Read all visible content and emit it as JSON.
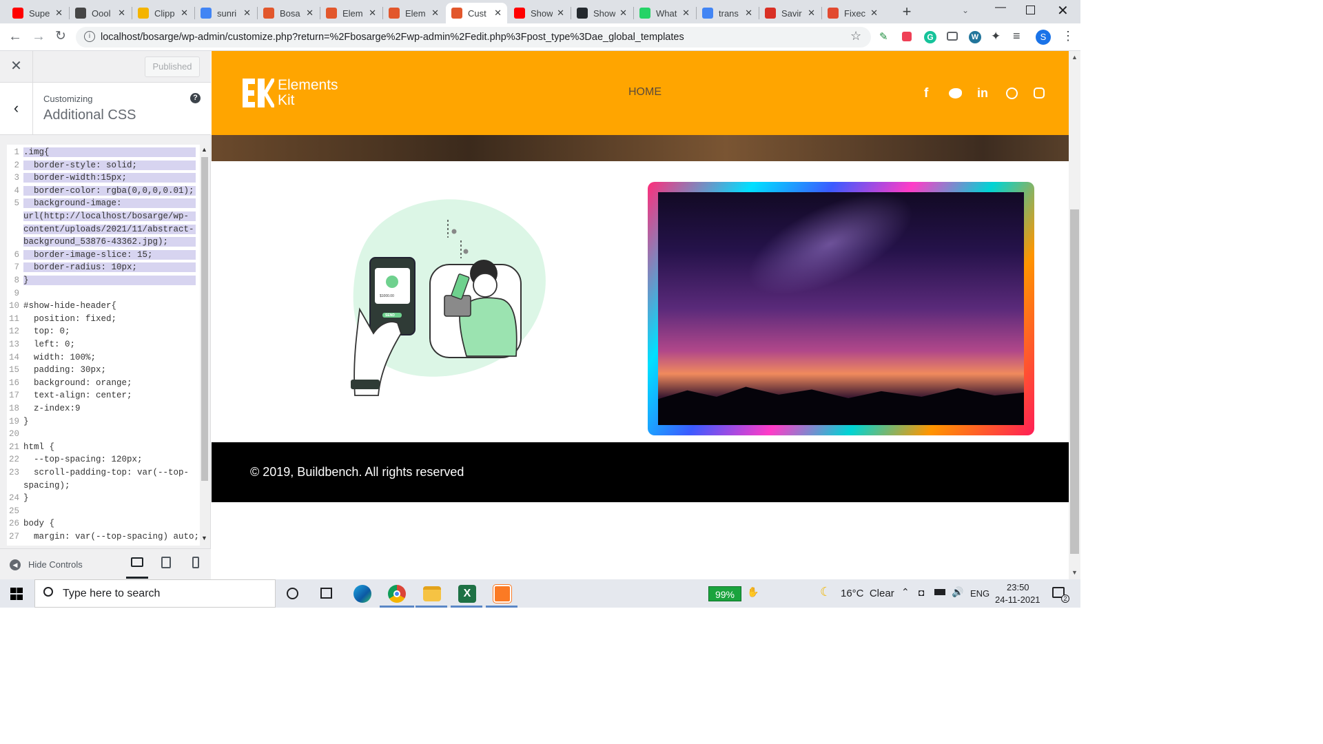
{
  "browser": {
    "tabs": [
      {
        "label": "Supe",
        "icon": "youtube-icon",
        "color": "#ff0000"
      },
      {
        "label": "Oool",
        "icon": "wordpress-icon",
        "color": "#464646"
      },
      {
        "label": "Clipp",
        "icon": "clipper-icon",
        "color": "#f4b400"
      },
      {
        "label": "sunri",
        "icon": "google-icon",
        "color": "#4285f4"
      },
      {
        "label": "Bosa",
        "icon": "elementor-icon",
        "color": "#e2572c"
      },
      {
        "label": "Elem",
        "icon": "elementor-icon",
        "color": "#e2572c"
      },
      {
        "label": "Elem",
        "icon": "elementor-icon",
        "color": "#e2572c"
      },
      {
        "label": "Cust",
        "icon": "elementor-icon",
        "color": "#e2572c",
        "active": true
      },
      {
        "label": "Show",
        "icon": "youtube-icon",
        "color": "#ff0000"
      },
      {
        "label": "Show",
        "icon": "github-icon",
        "color": "#24292e"
      },
      {
        "label": "What",
        "icon": "whatsapp-icon",
        "color": "#25d366"
      },
      {
        "label": "trans",
        "icon": "google-icon",
        "color": "#4285f4"
      },
      {
        "label": "Savir",
        "icon": "circle-icon",
        "color": "#d93025"
      },
      {
        "label": "Fixec",
        "icon": "asterisk-icon",
        "color": "#e24a30"
      }
    ],
    "new_tab": "+",
    "url": "localhost/bosarge/wp-admin/customize.php?return=%2Fbosarge%2Fwp-admin%2Fedit.php%3Fpost_type%3Dae_global_templates",
    "profile_initial": "S"
  },
  "customizer": {
    "published_label": "Published",
    "customizing_label": "Customizing",
    "section_title": "Additional CSS",
    "help_symbol": "?",
    "hide_controls_label": "Hide Controls",
    "code_lines": [
      {
        "n": "1",
        "text": ".img{",
        "sel": true
      },
      {
        "n": "2",
        "text": "  border-style: solid;",
        "sel": true
      },
      {
        "n": "3",
        "text": "  border-width:15px;",
        "sel": true
      },
      {
        "n": "4",
        "text": "  border-color: rgba(0,0,0,0.01);",
        "sel": true
      },
      {
        "n": "5",
        "text": "  background-image:",
        "sel": true
      },
      {
        "n": "",
        "text": "url(http://localhost/bosarge/wp-",
        "sel": true
      },
      {
        "n": "",
        "text": "content/uploads/2021/11/abstract-",
        "sel": true
      },
      {
        "n": "",
        "text": "background_53876-43362.jpg);",
        "sel": true
      },
      {
        "n": "6",
        "text": "  border-image-slice: 15;",
        "sel": true
      },
      {
        "n": "7",
        "text": "  border-radius: 10px;",
        "sel": true
      },
      {
        "n": "8",
        "text": "}",
        "sel": true
      },
      {
        "n": "9",
        "text": ""
      },
      {
        "n": "10",
        "text": "#show-hide-header{"
      },
      {
        "n": "11",
        "text": "  position: fixed;"
      },
      {
        "n": "12",
        "text": "  top: 0;"
      },
      {
        "n": "13",
        "text": "  left: 0;"
      },
      {
        "n": "14",
        "text": "  width: 100%;"
      },
      {
        "n": "15",
        "text": "  padding: 30px;"
      },
      {
        "n": "16",
        "text": "  background: orange;"
      },
      {
        "n": "17",
        "text": "  text-align: center;"
      },
      {
        "n": "18",
        "text": "  z-index:9"
      },
      {
        "n": "19",
        "text": "}"
      },
      {
        "n": "20",
        "text": ""
      },
      {
        "n": "21",
        "text": "html {"
      },
      {
        "n": "22",
        "text": "  --top-spacing: 120px;"
      },
      {
        "n": "23",
        "text": "  scroll-padding-top: var(--top-"
      },
      {
        "n": "",
        "text": "spacing);"
      },
      {
        "n": "24",
        "text": "}"
      },
      {
        "n": "25",
        "text": ""
      },
      {
        "n": "26",
        "text": "body {"
      },
      {
        "n": "27",
        "text": "  margin: var(--top-spacing) auto;"
      }
    ]
  },
  "site": {
    "logo_line1": "Elements",
    "logo_line2": "Kit",
    "nav_home": "HOME",
    "social": [
      "facebook-icon",
      "twitter-icon",
      "linkedin-icon",
      "dribbble-icon",
      "instagram-icon"
    ],
    "phone_amount": "$1000.00",
    "phone_send": "SEND",
    "footer_text": "© 2019, Buildbench. All rights reserved"
  },
  "taskbar": {
    "search_placeholder": "Type here to search",
    "battery": "99%",
    "weather": "16°C  Clear",
    "lang": "ENG",
    "time": "23:50",
    "date": "24-11-2021",
    "notifications": "2"
  }
}
